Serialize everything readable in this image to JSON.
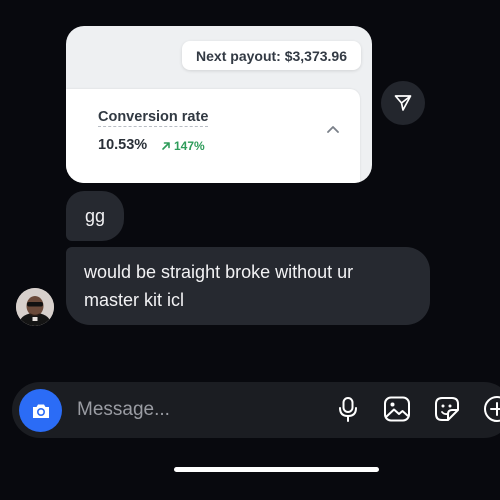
{
  "shared_image": {
    "payout_label": "Next payout: $3,373.96",
    "metric_title": "Conversion rate",
    "metric_value": "10.53%",
    "metric_delta": "147%",
    "metric_delta_color": "#2e9c5a"
  },
  "messages": [
    {
      "text": "gg"
    },
    {
      "text": "would be straight broke without ur master kit icl"
    }
  ],
  "composer": {
    "placeholder": "Message...",
    "icons": [
      "camera-icon",
      "microphone-icon",
      "gallery-icon",
      "sticker-icon",
      "add-icon"
    ],
    "accent_color": "#2b6cf6"
  },
  "colors": {
    "background": "#08090e",
    "bubble": "#262930"
  }
}
